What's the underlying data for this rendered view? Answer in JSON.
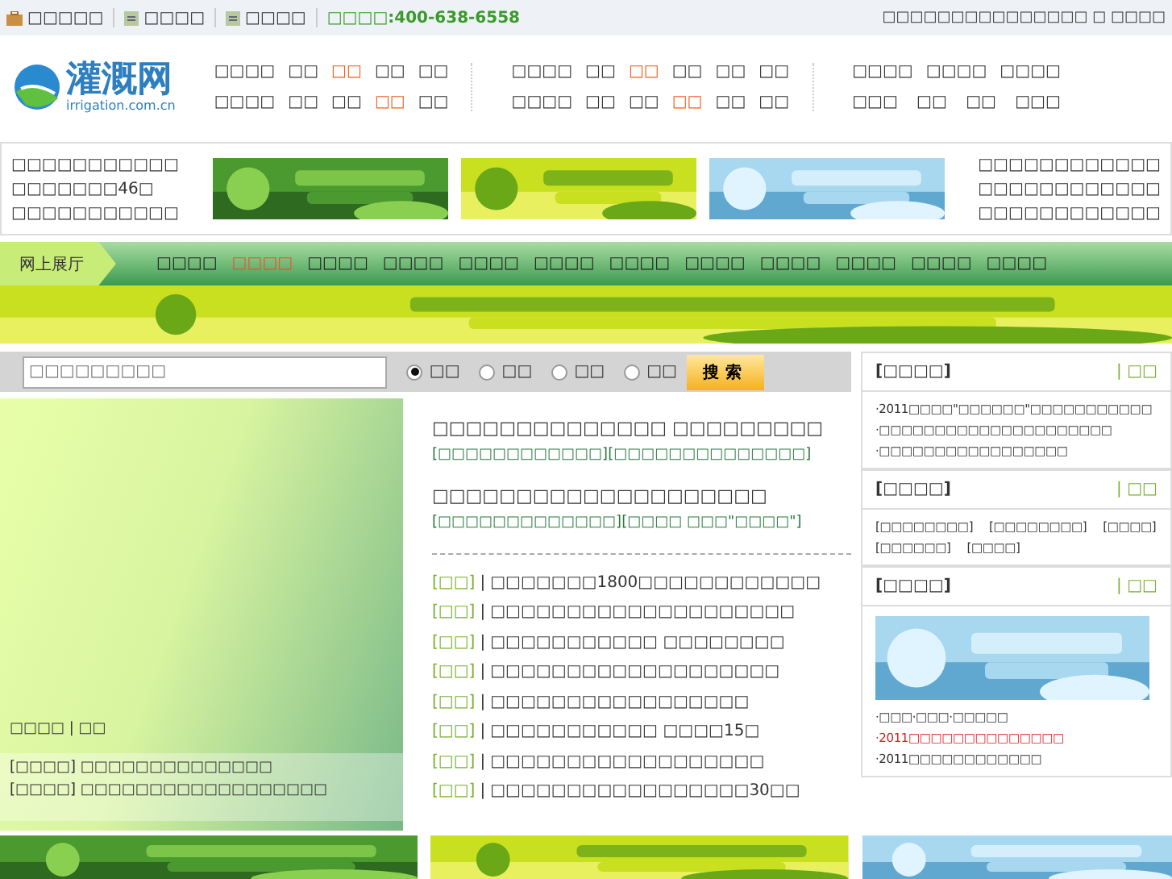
{
  "top_bar": {
    "links": [
      {
        "label": "□□□□□"
      },
      {
        "label": "□□□□"
      },
      {
        "label": "□□□□"
      }
    ],
    "hotline": "□□□□:400-638-6558",
    "right_text": "□□□□□□□□□□□□□□□ □ □□□□"
  },
  "logo": {
    "name": "灌溉网",
    "domain": "irrigation.com.cn"
  },
  "nav_groups": [
    {
      "upper_links": [
        {
          "label": "□□□□",
          "highlight": false
        },
        {
          "label": "□□",
          "highlight": false
        },
        {
          "label": "□□",
          "highlight": true
        },
        {
          "label": "□□",
          "highlight": false
        },
        {
          "label": "□□",
          "highlight": false
        }
      ],
      "lower_links": [
        {
          "label": "□□□□",
          "highlight": false
        },
        {
          "label": "□□",
          "highlight": false
        },
        {
          "label": "□□",
          "highlight": false
        },
        {
          "label": "□□",
          "highlight": true
        },
        {
          "label": "□□",
          "highlight": false
        }
      ]
    },
    {
      "upper_links": [
        {
          "label": "□□□□",
          "highlight": false
        },
        {
          "label": "□□",
          "highlight": false
        },
        {
          "label": "□□",
          "highlight": true
        },
        {
          "label": "□□",
          "highlight": false
        },
        {
          "label": "□□",
          "highlight": false
        },
        {
          "label": "□□",
          "highlight": false
        }
      ],
      "lower_links": [
        {
          "label": "□□□□",
          "highlight": false
        },
        {
          "label": "□□",
          "highlight": false
        },
        {
          "label": "□□",
          "highlight": false
        },
        {
          "label": "□□",
          "highlight": true
        },
        {
          "label": "□□",
          "highlight": false
        },
        {
          "label": "□□",
          "highlight": false
        }
      ]
    },
    {
      "upper_links": [
        {
          "label": "□□□□",
          "highlight": false
        },
        {
          "label": "□□□□",
          "highlight": false
        },
        {
          "label": "□□□□",
          "highlight": false
        }
      ],
      "lower_links": [
        {
          "label": "□□□",
          "highlight": false
        },
        {
          "label": "□□",
          "highlight": false
        },
        {
          "label": "□□",
          "highlight": false
        },
        {
          "label": "□□□",
          "highlight": false
        }
      ]
    }
  ],
  "ad_row": {
    "left_lines": [
      "□□□□□□□□□□□",
      "□□□□□□□46□",
      "□□□□□□□□□□□"
    ],
    "banners": [
      {
        "kind": "picture"
      },
      {
        "kind": "picture"
      },
      {
        "kind": "picture"
      }
    ],
    "right_lines": [
      "□□□□□□□□□□□□",
      "□□□□□□□□□□□□",
      "□□□□□□□□□□□□"
    ]
  },
  "channel_bar": {
    "title": "网上展厅",
    "items": [
      {
        "label": "□□□□",
        "selected": false
      },
      {
        "label": "□□□□",
        "selected": true
      },
      {
        "label": "□□□□",
        "selected": false
      },
      {
        "label": "□□□□",
        "selected": false
      },
      {
        "label": "□□□□",
        "selected": false
      },
      {
        "label": "□□□□",
        "selected": false
      },
      {
        "label": "□□□□",
        "selected": false
      },
      {
        "label": "□□□□",
        "selected": false
      },
      {
        "label": "□□□□",
        "selected": false
      },
      {
        "label": "□□□□",
        "selected": false
      },
      {
        "label": "□□□□",
        "selected": false
      },
      {
        "label": "□□□□",
        "selected": false
      }
    ]
  },
  "wide_banner": {
    "kind": "picture"
  },
  "search": {
    "placeholder": "□□□□□□□□□",
    "options": [
      {
        "label": "□□",
        "selected": true
      },
      {
        "label": "□□",
        "selected": false
      },
      {
        "label": "□□",
        "selected": false
      },
      {
        "label": "□□",
        "selected": false
      }
    ],
    "button": "搜索"
  },
  "slideshow": {
    "caption": "□□□□ | □□",
    "items": [
      {
        "tag": "[□□□□]",
        "text": "□□□□□□□□□□□□□□"
      },
      {
        "tag": "[□□□□]",
        "text": "□□□□□□□□□□□□□□□□□□"
      }
    ]
  },
  "headlines": [
    {
      "title": "□□□□□□□□□□□□□□ □□□□□□□□□",
      "links": [
        "[□□□□□□□□□□□□]",
        "[□□□□□□□□□□□□□□]"
      ]
    },
    {
      "title": "□□□□□□□□□□□□□□□□□□□□",
      "links": [
        "[□□□□□□□□□□□□□]",
        "[□□□□ □□□\"□□□□\"]"
      ]
    }
  ],
  "news_divider": "|",
  "news": [
    {
      "tag": "[□□]",
      "title": "□□□□□□□1800□□□□□□□□□□□□"
    },
    {
      "tag": "[□□]",
      "title": "□□□□□□□□□□□□□□□□□□□□"
    },
    {
      "tag": "[□□]",
      "title": "□□□□□□□□□□□ □□□□□□□□"
    },
    {
      "tag": "[□□]",
      "title": "□□□□□□□□□□□□□□□□□□□"
    },
    {
      "tag": "[□□]",
      "title": "□□□□□□□□□□□□□□□□□"
    },
    {
      "tag": "[□□]",
      "title": "□□□□□□□□□□□ □□□□15□"
    },
    {
      "tag": "[□□]",
      "title": "□□□□□□□□□□□□□□□□□□"
    },
    {
      "tag": "[□□]",
      "title": "□□□□□□□□□□□□□□□□□30□□"
    }
  ],
  "sidebar": [
    {
      "kind": "list",
      "title": "[□□□□]",
      "more": "| □□",
      "items": [
        {
          "text": "·2011□□□□\"□□□□□□\"□□□□□□□□□□□",
          "hot": false
        },
        {
          "text": "·□□□□□□□□□□□□□□□□□□□□□",
          "hot": false
        },
        {
          "text": "·□□□□□□□□□□□□□□□□□",
          "hot": false
        }
      ]
    },
    {
      "kind": "tags",
      "title": "[□□□□]",
      "more": "| □□",
      "items": [
        {
          "text": "[□□□□□□□□]",
          "hot": false
        },
        {
          "text": "[□□□□□□□□]",
          "hot": false
        },
        {
          "text": "[□□□□]",
          "hot": false
        },
        {
          "text": "[□□□□□□]",
          "hot": false
        },
        {
          "text": "[□□□□]",
          "hot": false
        }
      ]
    },
    {
      "kind": "banner_list",
      "title": "[□□□□]",
      "more": "| □□",
      "items": [
        {
          "text": "·□□□·□□□·□□□□□",
          "hot": false
        },
        {
          "text": "·2011□□□□□□□□□□□□□□",
          "hot": true
        },
        {
          "text": "·2011□□□□□□□□□□□□",
          "hot": false
        }
      ]
    }
  ],
  "bottom_banners": [
    {
      "kind": "picture"
    },
    {
      "kind": "picture"
    },
    {
      "kind": "picture"
    }
  ]
}
